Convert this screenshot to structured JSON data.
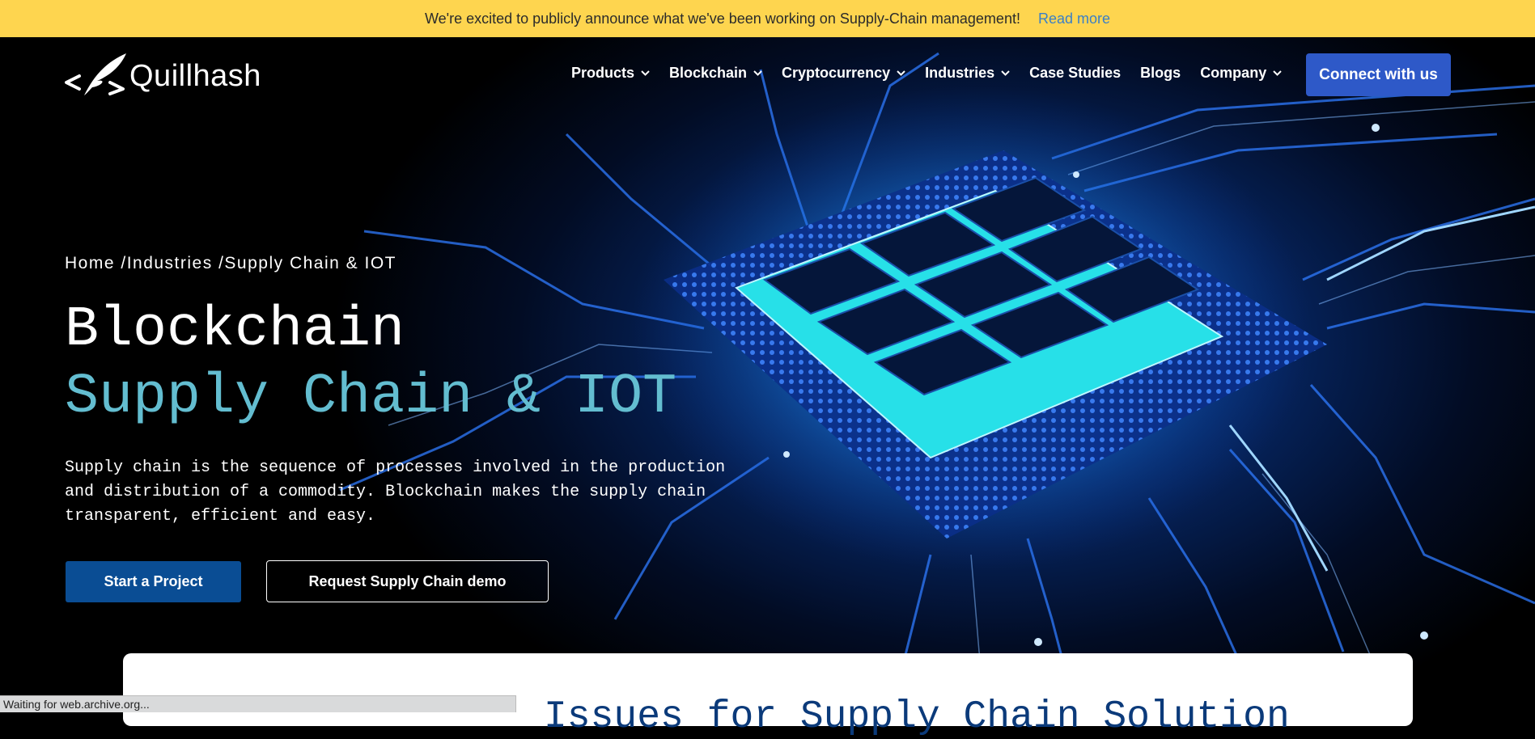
{
  "announcement": {
    "message": "We're excited to publicly announce what we've been working on Supply-Chain management!",
    "link_label": "Read more"
  },
  "header": {
    "logo_text": "Quillhash",
    "nav": [
      {
        "label": "Products",
        "dropdown": true
      },
      {
        "label": "Blockchain",
        "dropdown": true
      },
      {
        "label": "Cryptocurrency",
        "dropdown": true
      },
      {
        "label": "Industries",
        "dropdown": true
      },
      {
        "label": "Case Studies",
        "dropdown": false
      },
      {
        "label": "Blogs",
        "dropdown": false
      },
      {
        "label": "Company",
        "dropdown": true
      }
    ],
    "cta_label": "Connect with us"
  },
  "hero": {
    "breadcrumb": [
      "Home /",
      "Industries /",
      "Supply Chain & IOT"
    ],
    "title_line1": "Blockchain",
    "title_line2": "Supply Chain & IOT",
    "description": "Supply chain is the sequence of processes involved in the production and distribution of a commodity. Blockchain makes the supply chain transparent, efficient and easy.",
    "primary_button": "Start a Project",
    "secondary_button": "Request Supply Chain demo"
  },
  "card": {
    "heading": "Issues for Supply Chain Solution"
  },
  "browser_status": "Waiting for web.archive.org...",
  "colors": {
    "announcement_bg": "#fed54f",
    "link": "#3a7fc6",
    "cta_bg": "#2e59c8",
    "accent_teal": "#63bdd0",
    "primary_button_bg": "#0a4d94",
    "card_heading": "#0b3a7a"
  },
  "icons": {
    "logo": "quill-code-icon",
    "dropdown": "chevron-down-icon",
    "hero_image": "circuit-chip-illustration"
  }
}
